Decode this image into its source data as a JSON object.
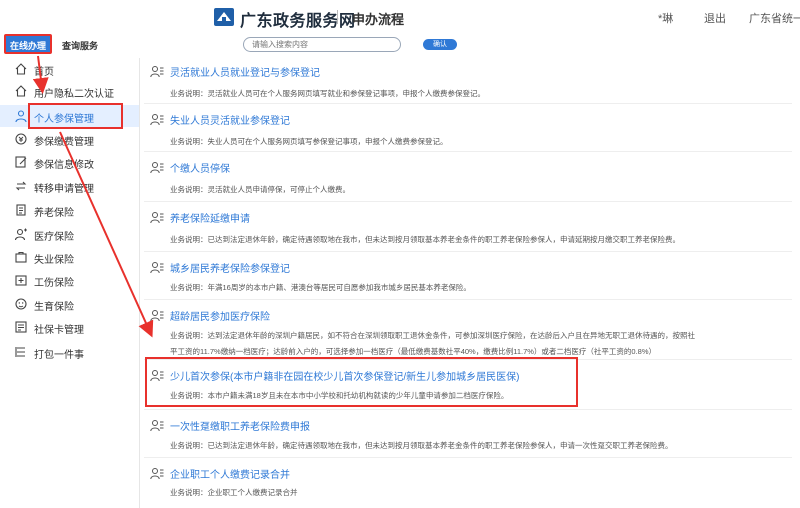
{
  "header": {
    "site_title": "广东政务服务网",
    "sub_title": "申办流程",
    "user_name": "*琳",
    "logout": "退出",
    "province": "广东省统一"
  },
  "toolbar": {
    "tab_online": "在线办理",
    "tab_query": "查询服务",
    "search_placeholder": "请输入搜索内容",
    "search_button": "确认"
  },
  "sidebar": {
    "items": [
      {
        "label": "首页",
        "icon": "home-icon"
      },
      {
        "label": "用户隐私二次认证",
        "icon": "home-icon"
      },
      {
        "label": "个人参保管理",
        "icon": "person-icon"
      },
      {
        "label": "参保缴费管理",
        "icon": "money-icon"
      },
      {
        "label": "参保信息修改",
        "icon": "edit-icon"
      },
      {
        "label": "转移申请管理",
        "icon": "transfer-icon"
      },
      {
        "label": "养老保险",
        "icon": "document-icon"
      },
      {
        "label": "医疗保险",
        "icon": "user-icon"
      },
      {
        "label": "失业保险",
        "icon": "briefcase-icon"
      },
      {
        "label": "工伤保险",
        "icon": "injury-icon"
      },
      {
        "label": "生育保险",
        "icon": "baby-icon"
      },
      {
        "label": "社保卡管理",
        "icon": "card-icon"
      },
      {
        "label": "打包一件事",
        "icon": "package-icon"
      }
    ]
  },
  "services": [
    {
      "title": "灵活就业人员就业登记与参保登记",
      "desc": "业务说明：灵活就业人员可在个人服务网页填写就业和参保登记事项，申报个人缴费参保登记。"
    },
    {
      "title": "失业人员灵活就业参保登记",
      "desc": "业务说明：失业人员可在个人服务网页填写参保登记事项，申报个人缴费参保登记。"
    },
    {
      "title": "个缴人员停保",
      "desc": "业务说明：灵活就业人员申请停保，可停止个人缴费。"
    },
    {
      "title": "养老保险延缴申请",
      "desc": "业务说明：已达到法定退休年龄，确定待遇领取地在我市，但未达到按月领取基本养老金条件的职工养老保险参保人，申请延期按月缴交职工养老保险费。"
    },
    {
      "title": "城乡居民养老保险参保登记",
      "desc": "业务说明：年满16周岁的本市户籍、港澳台等居民可自愿参加我市城乡居民基本养老保险。"
    },
    {
      "title": "超龄居民参加医疗保险",
      "desc": "业务说明：达到法定退休年龄的深圳户籍居民，如不符合在深圳领取职工退休金条件，可参加深圳医疗保险，在达龄后入户且在异地无职工退休待遇的，按照社",
      "desc2": "平工资的11.7%缴纳一档医疗；达龄前入户的，可选择参加一档医疗（最低缴费基数社平40%，缴费比例11.7%）或者二档医疗（社平工资的0.8%）"
    },
    {
      "title": "少儿首次参保(本市户籍非在园在校少儿首次参保登记/新生儿参加城乡居民医保)",
      "desc": "业务说明：本市户籍未满18岁且未在本市中小学校和托幼机构就读的少年儿童申请参加二档医疗保险。"
    },
    {
      "title": "一次性趸缴职工养老保险费申报",
      "desc": "业务说明：已达到法定退休年龄，确定待遇领取地在我市，但未达到按月领取基本养老金条件的职工养老保险参保人，申请一次性趸交职工养老保险费。"
    },
    {
      "title": "企业职工个人缴费记录合并",
      "desc": "业务说明：企业职工个人缴费记录合并"
    }
  ],
  "colors": {
    "accent": "#2f79d6",
    "highlight": "#e8312c"
  }
}
